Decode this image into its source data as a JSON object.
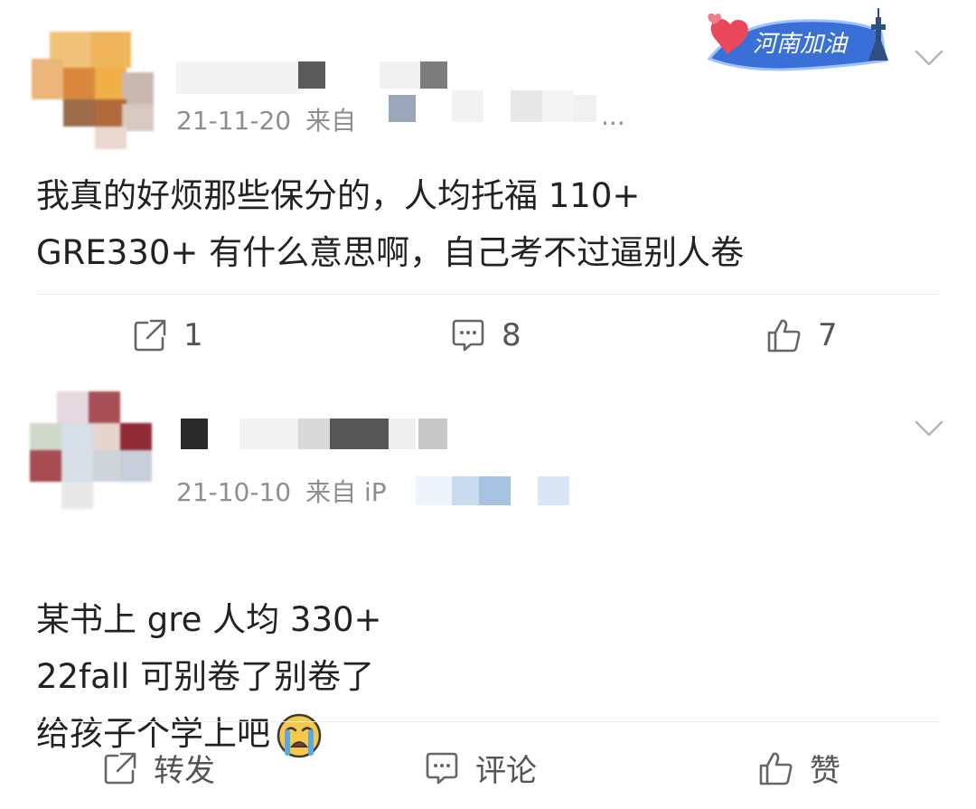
{
  "posts": [
    {
      "date": "21-11-20",
      "source_prefix": "来自",
      "source_suffix": "...",
      "badge_text": "河南加油",
      "content": "我真的好烦那些保分的，人均托福 110+\nGRE330+ 有什么意思啊，自己考不过逼别人卷",
      "actions": {
        "repost": "1",
        "comment": "8",
        "like": "7"
      }
    },
    {
      "date": "21-10-10",
      "source_prefix": "来自 iP",
      "content": "某书上 gre 人均 330+\n22fall 可别卷了别卷了\n给孩子个学上吧",
      "emoji": "crying-face",
      "actions": {
        "repost": "转发",
        "comment": "评论",
        "like": "赞"
      }
    }
  ],
  "colors": {
    "meta_gray": "#8e8e8e",
    "divider": "#ececec",
    "badge_blue": "#3a6fd8",
    "heart_red": "#e8485a"
  }
}
